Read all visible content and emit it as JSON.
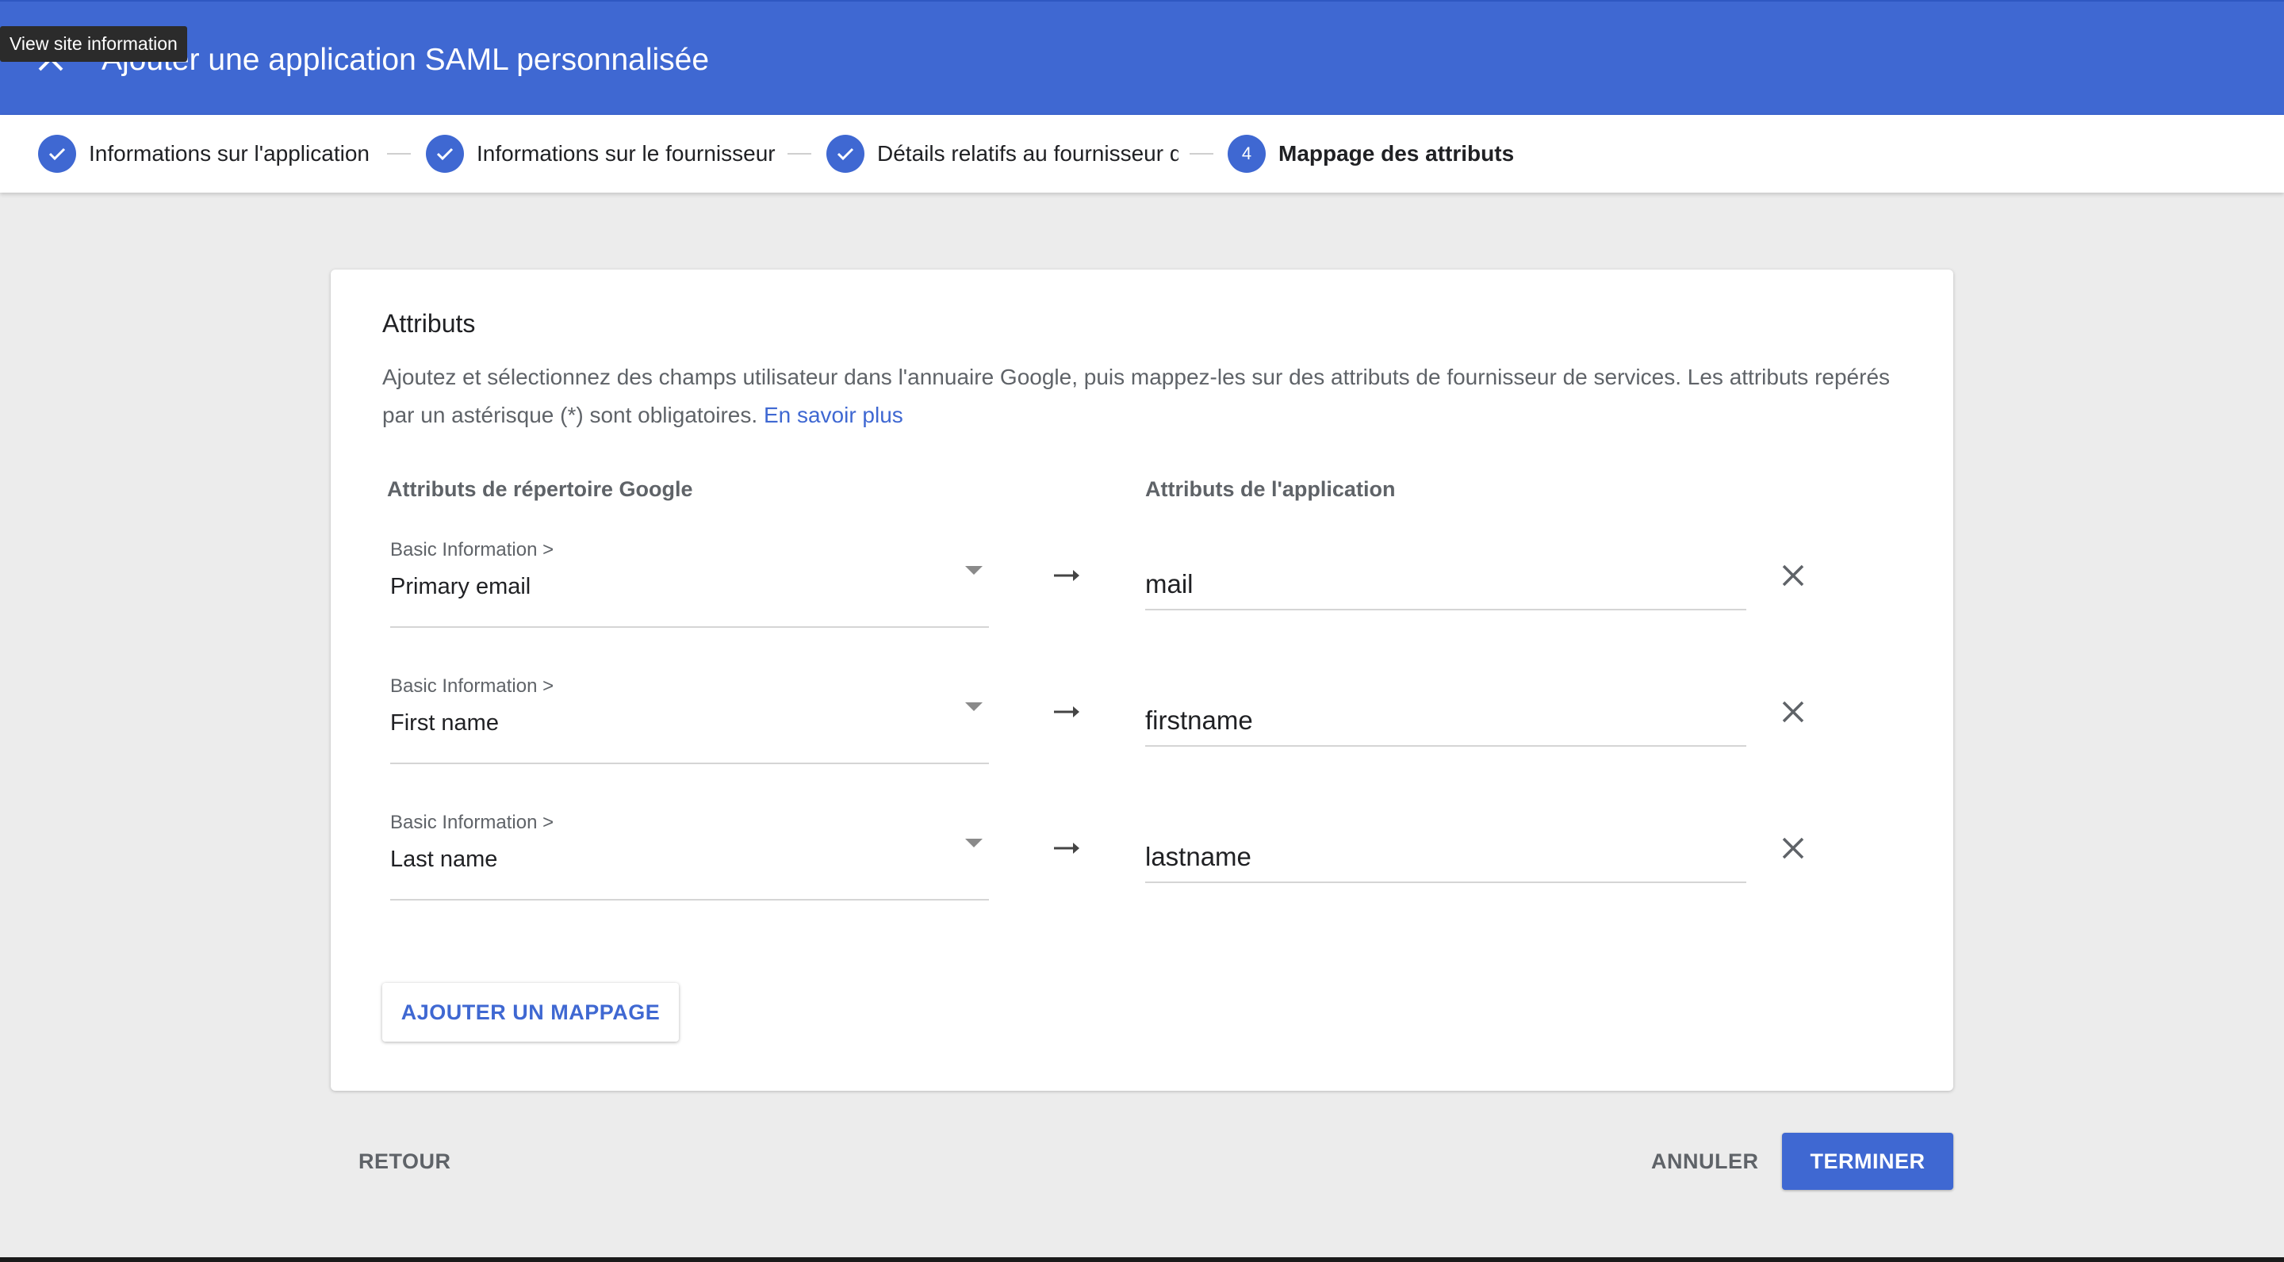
{
  "header": {
    "title": "Ajouter une application SAML personnalisée",
    "tooltip": "View site information",
    "color": "#3f68d2"
  },
  "stepper": {
    "steps": [
      {
        "label": "Informations sur l'application",
        "state": "completed",
        "icon": "check-icon"
      },
      {
        "label": "Informations sur le fournisseur d'identité Google",
        "state": "completed",
        "icon": "check-icon"
      },
      {
        "label": "Détails relatifs au fournisseur de services",
        "state": "completed",
        "icon": "check-icon"
      },
      {
        "label": "Mappage des attributs",
        "state": "active",
        "number": "4"
      }
    ]
  },
  "card": {
    "title": "Attributs",
    "description": "Ajoutez et sélectionnez des champs utilisateur dans l'annuaire Google, puis mappez-les sur des attributs de fournisseur de services. Les attributs repérés par un astérisque (*) sont obligatoires.",
    "learn_more": "En savoir plus",
    "col_left": "Attributs de répertoire Google",
    "col_right": "Attributs de l'application",
    "mappings": [
      {
        "category": "Basic Information >",
        "field": "Primary email",
        "app_attribute": "mail"
      },
      {
        "category": "Basic Information >",
        "field": "First name",
        "app_attribute": "firstname"
      },
      {
        "category": "Basic Information >",
        "field": "Last name",
        "app_attribute": "lastname"
      }
    ],
    "add_mapping": "AJOUTER UN MAPPAGE"
  },
  "footer": {
    "back": "RETOUR",
    "cancel": "ANNULER",
    "finish": "TERMINER"
  }
}
